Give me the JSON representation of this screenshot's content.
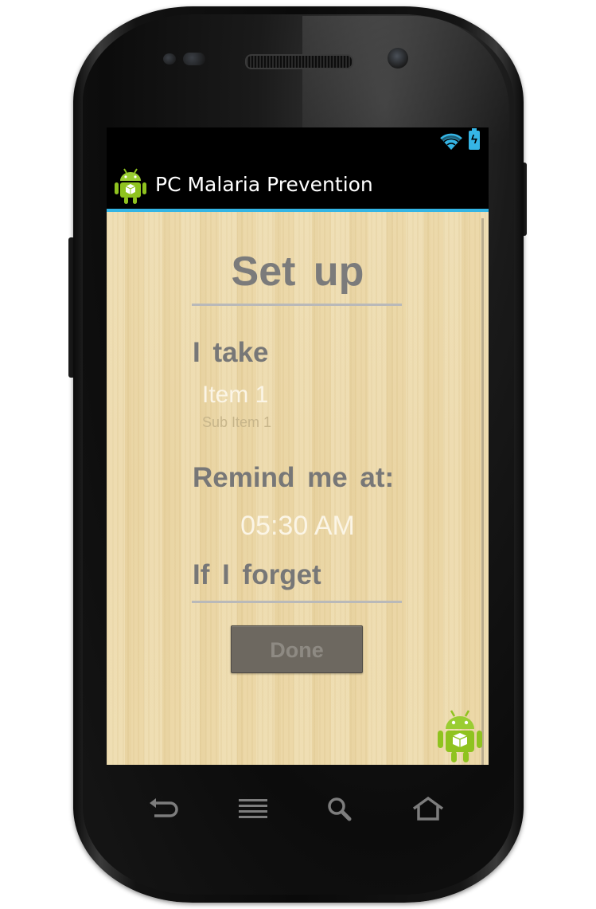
{
  "device": {
    "model": "android-phone",
    "hardware_buttons": [
      "back-icon",
      "menu-icon",
      "search-icon",
      "home-icon"
    ]
  },
  "status_bar": {
    "icons": [
      "wifi-icon",
      "battery-charging-icon"
    ],
    "accent_color": "#35b5e5"
  },
  "action_bar": {
    "app_icon": "android-robot-icon",
    "title": "PC Malaria Prevention",
    "underline_color": "#33b5e5"
  },
  "setup": {
    "title": "Set up",
    "take_label": "I take",
    "medication": {
      "selected": "Item 1",
      "sub": "Sub Item 1"
    },
    "remind_label": "Remind me at:",
    "time": "05:30 AM",
    "forget_label": "If I forget",
    "done_label": "Done"
  },
  "colors": {
    "background": "#ebd6a6",
    "label_text": "#777777",
    "value_text": "#fbf5e6",
    "button_bg": "#6d6860"
  }
}
